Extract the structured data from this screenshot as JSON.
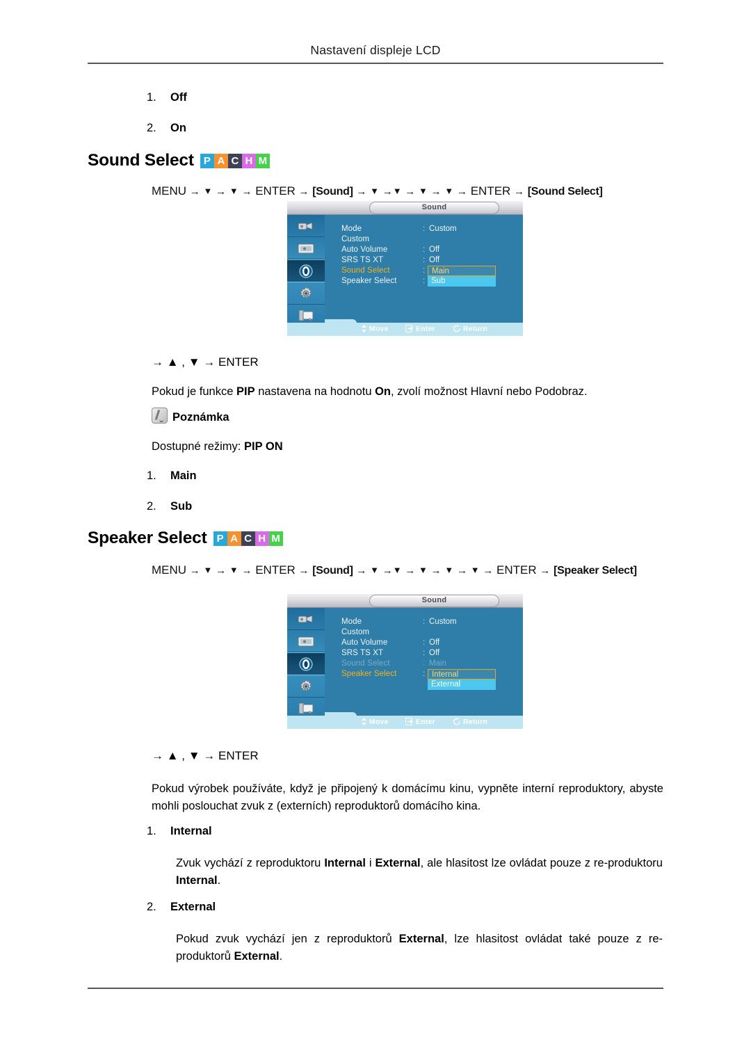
{
  "page": {
    "header_title": "Nastavení displeje LCD"
  },
  "top_list": [
    {
      "num": "1.",
      "label": "Off"
    },
    {
      "num": "2.",
      "label": "On"
    }
  ],
  "badges": [
    {
      "letter": "P",
      "color": "#28a8d8"
    },
    {
      "letter": "A",
      "color": "#f5912e"
    },
    {
      "letter": "C",
      "color": "#3d4354"
    },
    {
      "letter": "H",
      "color": "#d96ae8"
    },
    {
      "letter": "M",
      "color": "#45d24a"
    }
  ],
  "sections": [
    {
      "title": "Sound Select",
      "nav_tokens": [
        "MENU",
        "→",
        "▼",
        "→",
        "▼",
        "→",
        "ENTER",
        "→",
        "[Sound]",
        "→",
        "▼",
        "→",
        "▼",
        "→",
        "▼",
        "→",
        "▼",
        "→",
        "ENTER",
        "→",
        "[Sound Select]"
      ],
      "key_line": "→ ▲ , ▼ → ENTER",
      "description_html": "Pokud je funkce <b>PIP</b> nastavena na hodnotu <b>On</b>, zvolí možnost Hlavní nebo Podobraz.",
      "note_label": "Poznámka",
      "note_text_prefix": "Dostupné režimy:",
      "note_text_bold": "PIP ON",
      "options": [
        {
          "num": "1.",
          "label": "Main"
        },
        {
          "num": "2.",
          "label": "Sub"
        }
      ]
    },
    {
      "title": "Speaker Select",
      "nav_tokens": [
        "MENU",
        "→",
        "▼",
        "→",
        "▼",
        "→",
        "ENTER",
        "→",
        "[Sound]",
        "→",
        "▼",
        "→",
        "▼",
        "→",
        "▼",
        "→",
        "▼",
        "→",
        "▼",
        "→",
        "ENTER",
        "→",
        "[Speaker Select]"
      ],
      "key_line": "→ ▲ , ▼ → ENTER",
      "description_html": "Pokud výrobek používáte, když je připojený k domácímu kinu, vypněte interní reproduktory, abyste mohli poslouchat zvuk z (externích) reproduktorů domácího kina.",
      "options": [
        {
          "num": "1.",
          "label": "Internal",
          "body_html": "Zvuk vychází z reproduktoru <b>Internal</b> i <b>External</b>, ale hlasitost lze ovládat pouze z re-produktoru <b>Internal</b>."
        },
        {
          "num": "2.",
          "label": "External",
          "body_html": "Pokud zvuk vychází jen z reproduktorů <b>External</b>, lze hlasitost ovládat také pouze z re-produktorů <b>External</b>."
        }
      ]
    }
  ],
  "osd": [
    {
      "title": "Sound",
      "rows": [
        {
          "label": "Mode",
          "colon": ":",
          "value": "Custom",
          "state": "normal",
          "type": "text"
        },
        {
          "label": "Custom",
          "colon": "",
          "value": "",
          "state": "normal",
          "type": "text"
        },
        {
          "label": "Auto Volume",
          "colon": ":",
          "value": "Off",
          "state": "normal",
          "type": "text"
        },
        {
          "label": "SRS TS XT",
          "colon": ":",
          "value": "Off",
          "state": "normal",
          "type": "text"
        },
        {
          "label": "Sound Select",
          "colon": ":",
          "value": "Main",
          "state": "highlight",
          "type": "box-selected"
        },
        {
          "label": "Speaker Select",
          "colon": ":",
          "value": "Sub",
          "state": "normal",
          "type": "box-cyan"
        }
      ],
      "footer": [
        {
          "icon": "updown-icon",
          "label": "Move"
        },
        {
          "icon": "enter-icon",
          "label": "Enter"
        },
        {
          "icon": "return-icon",
          "label": "Return"
        }
      ]
    },
    {
      "title": "Sound",
      "rows": [
        {
          "label": "Mode",
          "colon": ":",
          "value": "Custom",
          "state": "normal",
          "type": "text"
        },
        {
          "label": "Custom",
          "colon": "",
          "value": "",
          "state": "normal",
          "type": "text"
        },
        {
          "label": "Auto Volume",
          "colon": ":",
          "value": "Off",
          "state": "normal",
          "type": "text"
        },
        {
          "label": "SRS TS XT",
          "colon": ":",
          "value": "Off",
          "state": "normal",
          "type": "text"
        },
        {
          "label": "Sound Select",
          "colon": ":",
          "value": "Main",
          "state": "dim",
          "type": "text"
        },
        {
          "label": "Speaker Select",
          "colon": ":",
          "value": "Internal",
          "state": "highlight",
          "type": "box-selected"
        },
        {
          "label": "",
          "colon": "",
          "value": "External",
          "state": "normal",
          "type": "box-cyan"
        }
      ],
      "footer": [
        {
          "icon": "updown-icon",
          "label": "Move"
        },
        {
          "icon": "enter-icon",
          "label": "Enter"
        },
        {
          "icon": "return-icon",
          "label": "Return"
        }
      ]
    }
  ],
  "osd_sidebar_icons": [
    "input-source-icon",
    "picture-icon",
    "sound-icon",
    "setup-icon",
    "multicontrol-icon"
  ]
}
